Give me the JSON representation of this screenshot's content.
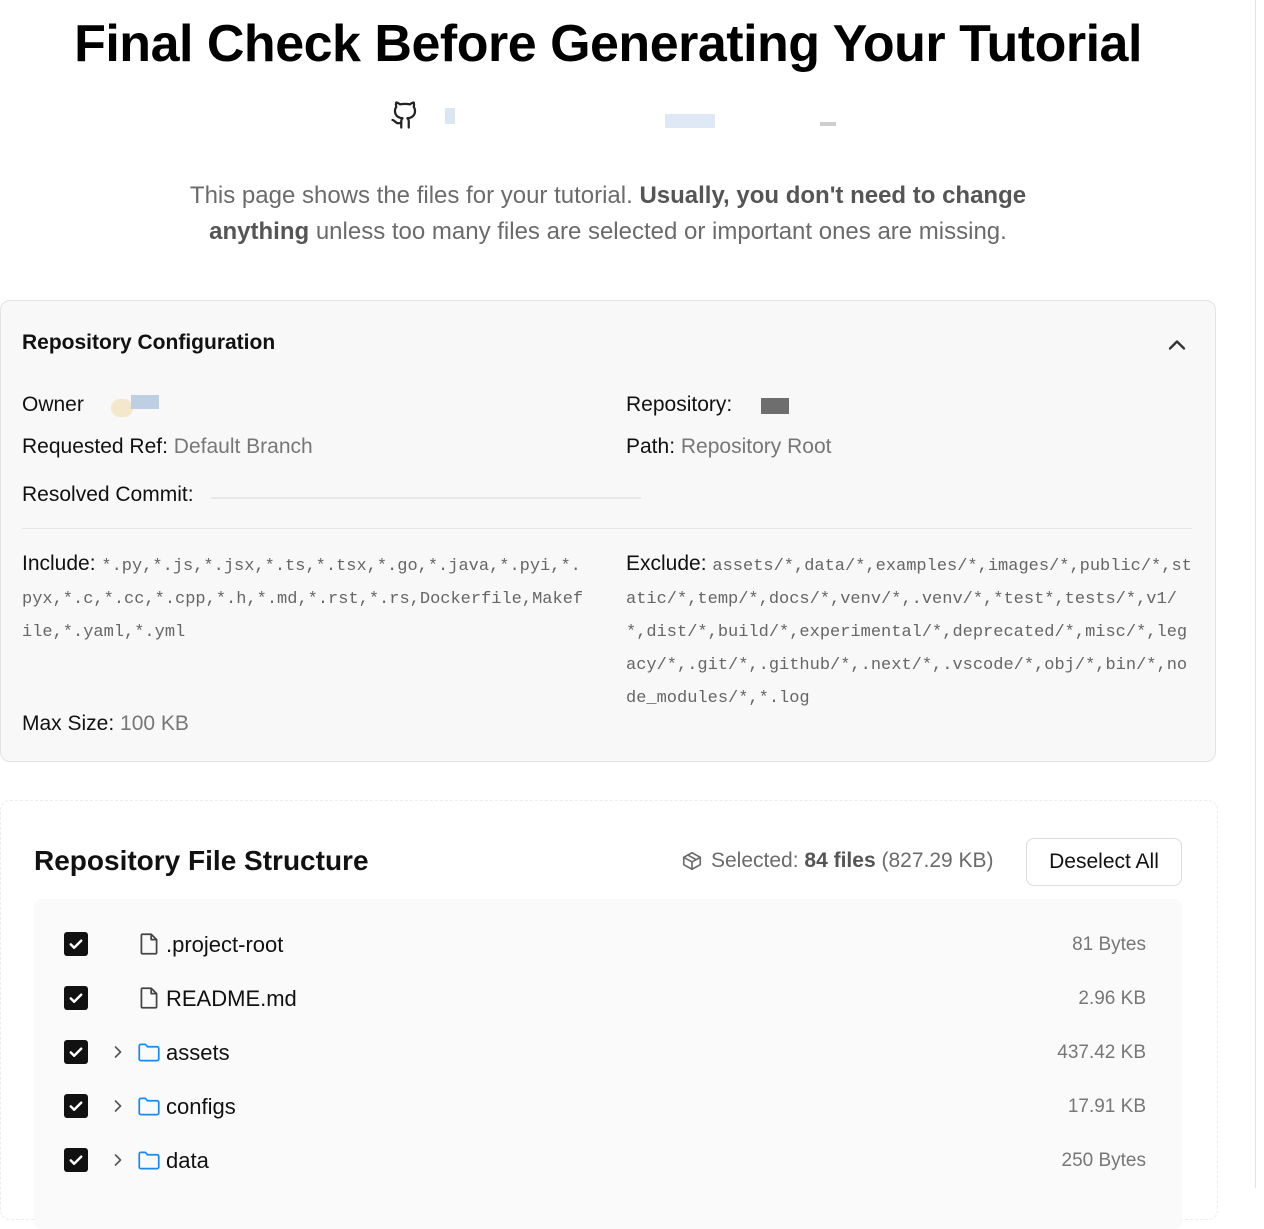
{
  "header": {
    "title": "Final Check Before Generating Your Tutorial"
  },
  "intro": {
    "text_before": "This page shows the files for your tutorial. ",
    "text_bold": "Usually, you don't need to change anything",
    "text_after": " unless too many files are selected or important ones are missing."
  },
  "config": {
    "title": "Repository Configuration",
    "owner_label": "Owner",
    "repository_label": "Repository:",
    "requested_ref_label": "Requested Ref:",
    "requested_ref_value": "Default Branch",
    "path_label": "Path:",
    "path_value": "Repository Root",
    "resolved_commit_label": "Resolved Commit:",
    "include_label": "Include:",
    "include_value": "*.py,*.js,*.jsx,*.ts,*.tsx,*.go,*.java,*.pyi,*.pyx,*.c,*.cc,*.cpp,*.h,*.md,*.rst,*.rs,Dockerfile,Makefile,*.yaml,*.yml",
    "exclude_label": "Exclude:",
    "exclude_value": "assets/*,data/*,examples/*,images/*,public/*,static/*,temp/*,docs/*,venv/*,.venv/*,*test*,tests/*,v1/*,dist/*,build/*,experimental/*,deprecated/*,misc/*,legacy/*,.git/*,.github/*,.next/*,.vscode/*,obj/*,bin/*,node_modules/*,*.log",
    "max_size_label": "Max Size:",
    "max_size_value": "100 KB"
  },
  "files": {
    "title": "Repository File Structure",
    "selected_label": "Selected:",
    "selected_count": "84 files",
    "selected_size": "(827.29 KB)",
    "deselect_label": "Deselect All",
    "items": [
      {
        "name": ".project-root",
        "size": "81 Bytes",
        "type": "file",
        "checked": true
      },
      {
        "name": "README.md",
        "size": "2.96 KB",
        "type": "file",
        "checked": true
      },
      {
        "name": "assets",
        "size": "437.42 KB",
        "type": "folder",
        "checked": true
      },
      {
        "name": "configs",
        "size": "17.91 KB",
        "type": "folder",
        "checked": true
      },
      {
        "name": "data",
        "size": "250 Bytes",
        "type": "folder",
        "checked": true
      }
    ]
  },
  "icons": {
    "repo": "github-icon",
    "collapse": "chevron-up-icon",
    "selected": "package-icon",
    "checkbox": "check-icon",
    "expand": "chevron-right-icon",
    "file": "file-icon",
    "folder": "folder-icon"
  },
  "colors": {
    "folder_icon": "#1e88e5",
    "checkbox": "#111111",
    "muted_text": "#777777"
  }
}
